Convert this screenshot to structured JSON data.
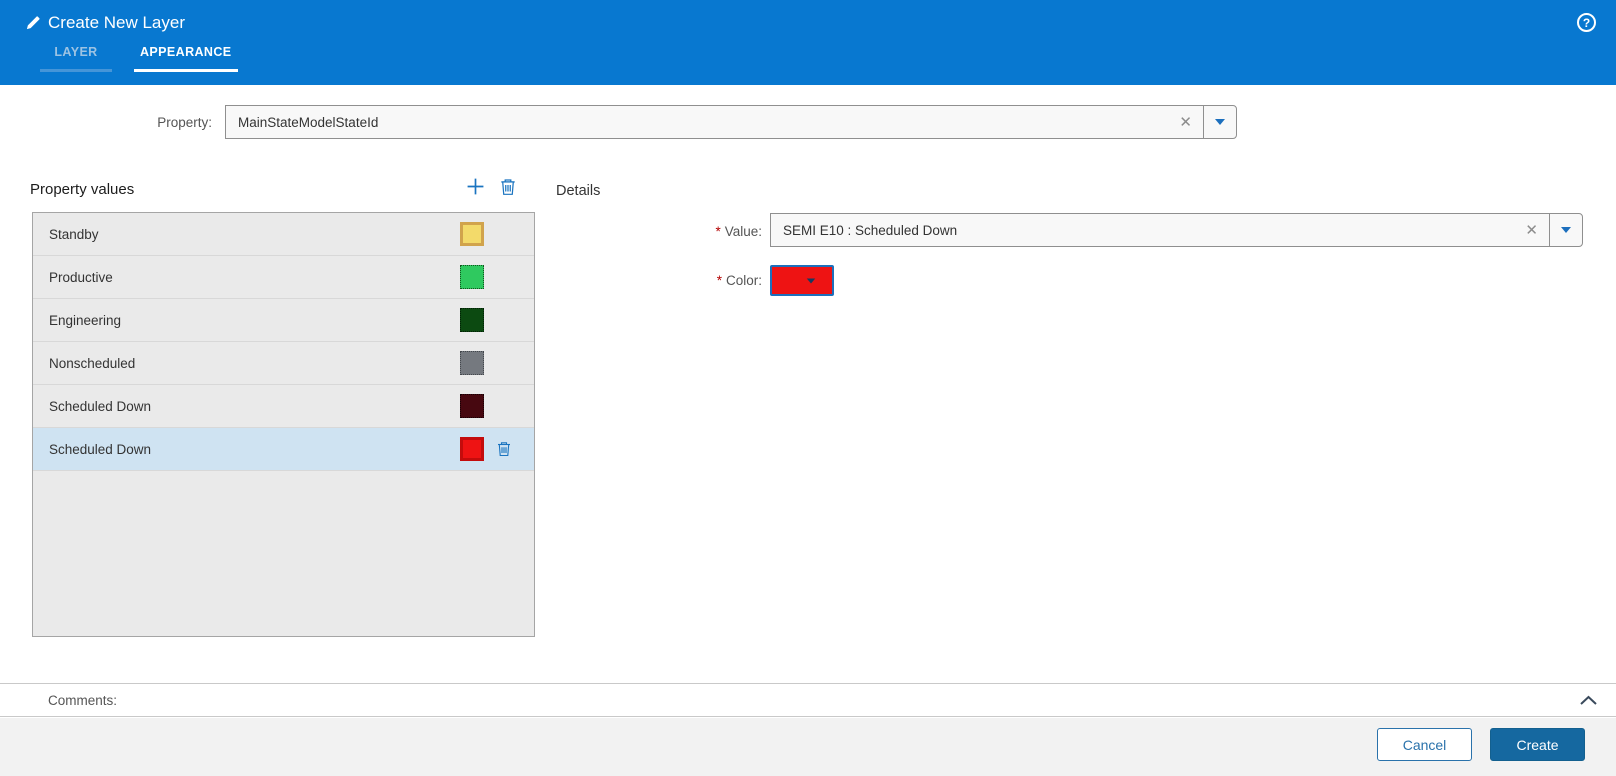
{
  "header": {
    "title": "Create New Layer",
    "help_icon": "?",
    "tabs": [
      {
        "label": "LAYER",
        "active": false
      },
      {
        "label": "APPEARANCE",
        "active": true
      }
    ]
  },
  "property": {
    "label": "Property:",
    "value": "MainStateModelStateId"
  },
  "property_values": {
    "title": "Property values",
    "items": [
      {
        "label": "Standby",
        "fill": "#f3da6a",
        "border_color": "#d1a34c",
        "border_style": "thick",
        "speckled": false,
        "selected": false
      },
      {
        "label": "Productive",
        "fill": "#2fc95f",
        "border_color": "#14521f",
        "border_style": "dotted",
        "speckled": false,
        "selected": false
      },
      {
        "label": "Engineering",
        "fill": "#0c4a11",
        "border_color": "#031f06",
        "border_style": "dotted",
        "speckled": false,
        "selected": false
      },
      {
        "label": "Nonscheduled",
        "fill": "#75797f",
        "border_color": "#43474c",
        "border_style": "dotted",
        "speckled": true,
        "selected": false
      },
      {
        "label": "Scheduled Down",
        "fill": "#470810",
        "border_color": "#160105",
        "border_style": "dotted",
        "speckled": false,
        "selected": false
      },
      {
        "label": "Scheduled Down",
        "fill": "#ee1313",
        "border_color": "#c40c0c",
        "border_style": "thick",
        "speckled": false,
        "selected": true
      }
    ]
  },
  "details": {
    "title": "Details",
    "required_marker": "*",
    "value_label": "Value:",
    "value": "SEMI E10 : Scheduled Down",
    "color_label": "Color:",
    "color": "#ee1313"
  },
  "comments": {
    "label": "Comments:"
  },
  "footer": {
    "cancel_label": "Cancel",
    "create_label": "Create"
  },
  "colors": {
    "accent": "#0878d0",
    "selection": "#cfe3f2",
    "icon_blue": "#1a74c0"
  }
}
